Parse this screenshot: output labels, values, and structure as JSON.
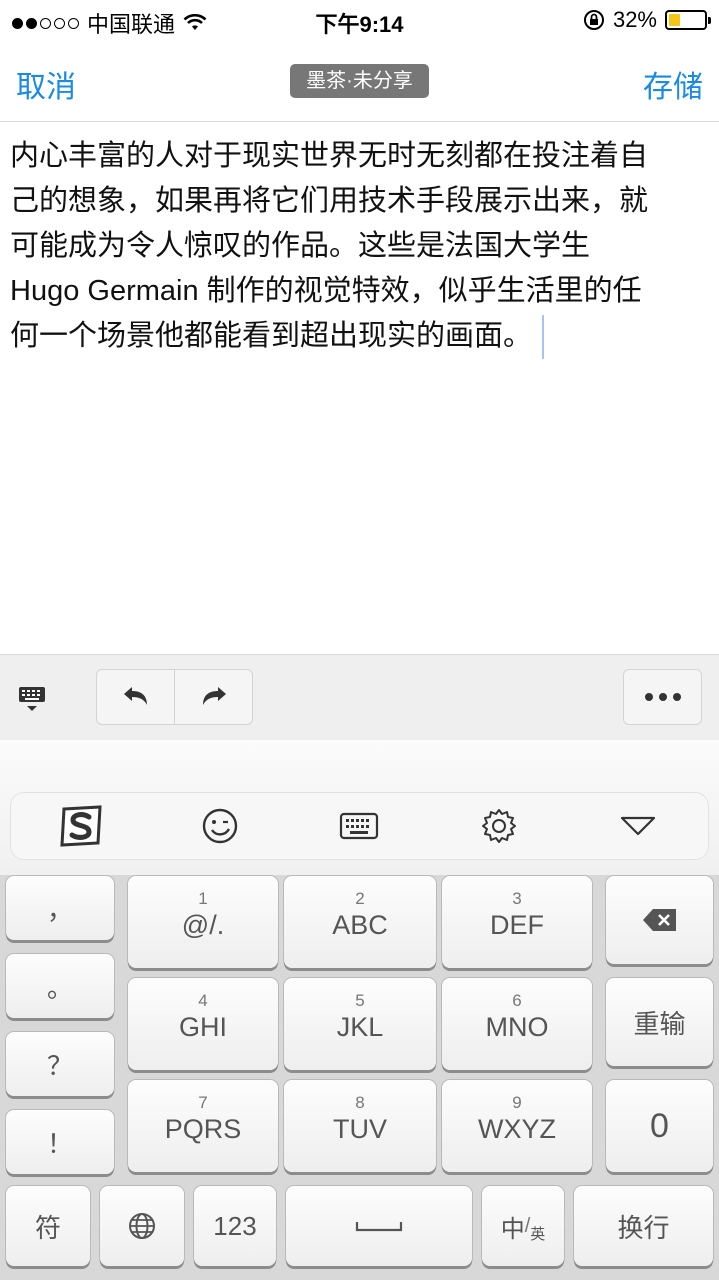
{
  "status_bar": {
    "carrier": "中国联通",
    "time": "下午9:14",
    "battery_percent": "32%",
    "battery_level": 0.32,
    "signal_bars_filled": 2,
    "signal_bars_total": 5
  },
  "nav": {
    "cancel_label": "取消",
    "title_badge": "墨茶·未分享",
    "save_label": "存储"
  },
  "editor": {
    "lines": [
      "内心丰富的人对于现实世界无时无刻都在投注着自",
      "己的想象，如果再将它们用技术手段展示出来，就",
      "可能成为令人惊叹的作品。这些是法国大学生",
      "Hugo Germain 制作的视觉特效，似乎生活里的任",
      "何一个场景他都能看到超出现实的画面。"
    ]
  },
  "toolbar": {
    "keyboard_toggle_icon": "keyboard-dismiss-icon",
    "undo_icon": "undo-icon",
    "redo_icon": "redo-icon",
    "more_icon": "more-icon"
  },
  "keyboard": {
    "tools": [
      "sogou-logo-icon",
      "emoji-icon",
      "keyboard-icon",
      "settings-icon",
      "collapse-icon"
    ],
    "punct_keys": [
      "，",
      "。",
      "？",
      "！"
    ],
    "t9_keys": [
      {
        "num": "1",
        "label": "@/."
      },
      {
        "num": "2",
        "label": "ABC"
      },
      {
        "num": "3",
        "label": "DEF"
      },
      {
        "num": "4",
        "label": "GHI"
      },
      {
        "num": "5",
        "label": "JKL"
      },
      {
        "num": "6",
        "label": "MNO"
      },
      {
        "num": "7",
        "label": "PQRS"
      },
      {
        "num": "8",
        "label": "TUV"
      },
      {
        "num": "9",
        "label": "WXYZ"
      }
    ],
    "reinput_label": "重输",
    "zero_label": "0",
    "symbol_label": "符",
    "num_label": "123",
    "space_label": "␣",
    "zh_label": "中",
    "en_label": "英",
    "enter_label": "换行"
  },
  "colors": {
    "accent": "#1b8ae5",
    "battery": "#f5c518",
    "badge_bg": "#777777"
  }
}
